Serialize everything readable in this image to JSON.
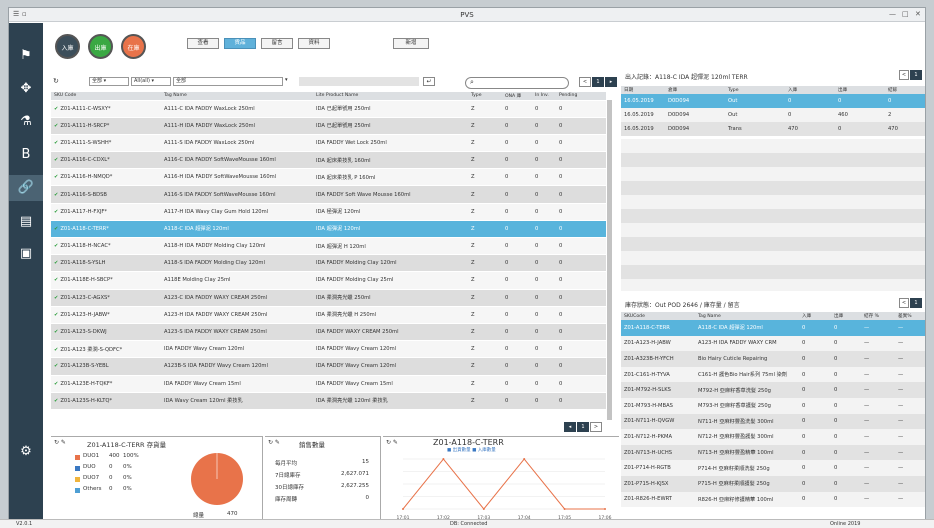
{
  "app": {
    "title": "PVS"
  },
  "sidebar": {
    "items": [
      {
        "icon": "flag-icon",
        "glyph": "⚑"
      },
      {
        "icon": "move-icon",
        "glyph": "✥"
      },
      {
        "icon": "flask-icon",
        "glyph": "⚗"
      },
      {
        "icon": "bold-b-icon",
        "glyph": "B"
      },
      {
        "icon": "link-icon",
        "glyph": "🔗"
      },
      {
        "icon": "document-icon",
        "glyph": "▤"
      },
      {
        "icon": "folder-icon",
        "glyph": "▣"
      },
      {
        "icon": "settings-icon",
        "glyph": "⚙"
      }
    ]
  },
  "circles": [
    {
      "label": "入庫",
      "color": "#3c4e5a"
    },
    {
      "label": "出庫",
      "color": "#3aa843"
    },
    {
      "label": "在庫",
      "color": "#e8734a"
    }
  ],
  "tabs": [
    "查看",
    "貨品",
    "留言",
    "資料"
  ],
  "tab_new": "新增",
  "filters": {
    "f1": "全部",
    "f2": "All(all) ",
    "f3": "全部"
  },
  "main_pager": {
    "prev": "<",
    "current": "1"
  },
  "main_table": {
    "headers": [
      "SKU Code",
      "Tag Name",
      "Lite Product Name",
      "Type",
      "ONA 庫",
      "In Inv.",
      "Pending"
    ],
    "rows": [
      {
        "sku": "Z01-A111-C-WSXY*",
        "tag": "A111-C IDA FADDY WaxLock 250ml",
        "name": "IDA 已起單號用 250ml",
        "type": "Z",
        "a": "0",
        "b": "0",
        "c": "0",
        "cls": "w"
      },
      {
        "sku": "Z01-A111-H-SRCP*",
        "tag": "A111-H IDA FADDY WaxLock 250ml",
        "name": "IDA 已起單號用 250ml",
        "type": "Z",
        "a": "0",
        "b": "0",
        "c": "0",
        "cls": "g"
      },
      {
        "sku": "Z01-A111-S-WSHH*",
        "tag": "A111-S IDA FADDY WaxLock 250ml",
        "name": "IDA FADDY Wet Lock 250ml",
        "type": "Z",
        "a": "0",
        "b": "0",
        "c": "0",
        "cls": "w"
      },
      {
        "sku": "Z01-A116-C-CDXL*",
        "tag": "A116-C IDA FADDY SoftWaveMousse 160ml",
        "name": "IDA 起床柔技乳 160ml",
        "type": "Z",
        "a": "0",
        "b": "0",
        "c": "0",
        "cls": "g"
      },
      {
        "sku": "Z01-A116-H-NMQD*",
        "tag": "A116-H IDA FADDY SoftWaveMousse 160ml",
        "name": "IDA 起床柔技乳 P 160ml",
        "type": "Z",
        "a": "0",
        "b": "0",
        "c": "0",
        "cls": "w"
      },
      {
        "sku": "Z01-A116-S-BDSB",
        "tag": "A116-S IDA FADDY SoftWaveMousse 160ml",
        "name": "IDA FADDY Soft Wave Mousse 160ml",
        "type": "Z",
        "a": "0",
        "b": "0",
        "c": "0",
        "cls": "g"
      },
      {
        "sku": "Z01-A117-H-FXJF*",
        "tag": "A117-H IDA Wavy Clay Gum Hold 120ml",
        "name": "IDA 極彈泥 120ml",
        "type": "Z",
        "a": "0",
        "b": "0",
        "c": "0",
        "cls": "w"
      },
      {
        "sku": "Z01-A118-C-TERR*",
        "tag": "A118-C IDA 超彈泥 120ml",
        "name": "IDA 超彈泥 120ml",
        "type": "Z",
        "a": "0",
        "b": "0",
        "c": "0",
        "cls": "sel"
      },
      {
        "sku": "Z01-A118-H-NCAC*",
        "tag": "A118-H IDA FADDY Molding Clay 120ml",
        "name": "IDA 超彈泥 H 120ml",
        "type": "Z",
        "a": "0",
        "b": "0",
        "c": "0",
        "cls": "w"
      },
      {
        "sku": "Z01-A118-S-YSLH",
        "tag": "A118-S IDA FADDY Molding Clay 120ml",
        "name": "IDA FADDY Molding Clay 120ml",
        "type": "Z",
        "a": "0",
        "b": "0",
        "c": "0",
        "cls": "g"
      },
      {
        "sku": "Z01-A118E-H-SBCP*",
        "tag": "A118E Molding Clay 25ml",
        "name": "IDA FADDY Molding Clay 25ml",
        "type": "Z",
        "a": "0",
        "b": "0",
        "c": "0",
        "cls": "w"
      },
      {
        "sku": "Z01-A123-C-AGXS*",
        "tag": "A123-C IDA FADDY WAXY CREAM 250ml",
        "name": "IDA 柔潤亮光蠟 250ml",
        "type": "Z",
        "a": "0",
        "b": "0",
        "c": "0",
        "cls": "g"
      },
      {
        "sku": "Z01-A123-H-JABW*",
        "tag": "A123-H IDA FADDY WAXY CREAM 250ml",
        "name": "IDA 柔潤亮光蠟 H 250ml",
        "type": "Z",
        "a": "0",
        "b": "0",
        "c": "0",
        "cls": "w"
      },
      {
        "sku": "Z01-A123-S-DKWJ",
        "tag": "A123-S IDA FADDY WAXY CREAM 250ml",
        "name": "IDA FADDY WAXY CREAM 250ml",
        "type": "Z",
        "a": "0",
        "b": "0",
        "c": "0",
        "cls": "g"
      },
      {
        "sku": "Z01-A123 柔潤-S-QDFC*",
        "tag": "IDA FADDY Wavy Cream 120ml",
        "name": "IDA FADDY Wavy Cream 120ml",
        "type": "Z",
        "a": "0",
        "b": "0",
        "c": "0",
        "cls": "w"
      },
      {
        "sku": "Z01-A123B-S-YEBL",
        "tag": "A123B-S IDA FADDY Wavy Cream 120ml",
        "name": "IDA FADDY Wavy Cream 120ml",
        "type": "Z",
        "a": "0",
        "b": "0",
        "c": "0",
        "cls": "g"
      },
      {
        "sku": "Z01-A123E-H-TQKF*",
        "tag": "IDA FADDY Wavy Cream 15ml",
        "name": "IDA FADDY Wavy Cream 15ml",
        "type": "Z",
        "a": "0",
        "b": "0",
        "c": "0",
        "cls": "w"
      },
      {
        "sku": "Z01-A123S-H-KLTQ*",
        "tag": "IDA Wavy Cream 120ml 柔技乳",
        "name": "IDA 柔潤亮光蠟 120ml 柔技乳",
        "type": "Z",
        "a": "0",
        "b": "0",
        "c": "0",
        "cls": "g"
      }
    ]
  },
  "bottom_pager": {
    "page": "1",
    "next": ">"
  },
  "right_top": {
    "title": "出入記錄：A118-C IDA 超彈泥 120ml TERR",
    "headers": [
      "日期",
      "倉庫",
      "Type",
      "入庫",
      "出庫",
      "結餘"
    ],
    "rows": [
      {
        "date": "16.05.2019",
        "wh": "D0D094",
        "type": "Out",
        "in": "0",
        "out": "0",
        "bal": "0",
        "cls": "sel"
      },
      {
        "date": "16.05.2019",
        "wh": "D0D094",
        "type": "Out",
        "in": "0",
        "out": "460",
        "bal": "2",
        "cls": "w"
      },
      {
        "date": "16.05.2019",
        "wh": "D0D094",
        "type": "Trans",
        "in": "470",
        "out": "0",
        "bal": "470",
        "cls": "g"
      }
    ]
  },
  "right_bottom": {
    "title": "庫存狀態：Out POD 2646 / 庫存量 / 留言",
    "headers": [
      "SKUCode",
      "Tag Name",
      "入庫",
      "出庫",
      "結存 %",
      "差異%"
    ],
    "rows": [
      {
        "a": "Z01-A118-C-TERR",
        "b": "A118-C IDA 超彈泥 120ml",
        "c": "0",
        "d": "0",
        "e": "—",
        "f": "—",
        "cls": "sel"
      },
      {
        "a": "Z01-A123-H-JABW",
        "b": "A123-H IDA FADDY WAXY CRM",
        "c": "0",
        "d": "0",
        "e": "—",
        "f": "—",
        "cls": "w"
      },
      {
        "a": "Z01-A323B-H-YFCH",
        "b": "Bio Hairy Cuticle Repairing",
        "c": "0",
        "d": "0",
        "e": "—",
        "f": "—",
        "cls": "g"
      },
      {
        "a": "Z01-C161-H-TYVA",
        "b": "C161-H 護色Bio Hair系列 75ml 染劑",
        "c": "0",
        "d": "0",
        "e": "—",
        "f": "—",
        "cls": "w"
      },
      {
        "a": "Z01-M792-H-SLKS",
        "b": "M792-H 亞麻籽香草洗髮 250g",
        "c": "0",
        "d": "0",
        "e": "—",
        "f": "—",
        "cls": "g"
      },
      {
        "a": "Z01-M793-H-MBAS",
        "b": "M793-H 亞麻籽香草護髮 250g",
        "c": "0",
        "d": "0",
        "e": "—",
        "f": "—",
        "cls": "w"
      },
      {
        "a": "Z01-N711-H-QVGW",
        "b": "N711-H 亞麻籽豐盈洗髮 300ml",
        "c": "0",
        "d": "0",
        "e": "—",
        "f": "—",
        "cls": "g"
      },
      {
        "a": "Z01-N712-H-PKMA",
        "b": "N712-H 亞麻籽豐盈護髮 300ml",
        "c": "0",
        "d": "0",
        "e": "—",
        "f": "—",
        "cls": "w"
      },
      {
        "a": "Z01-N713-H-UCHS",
        "b": "N713-H 亞麻籽豐盈精華 100ml",
        "c": "0",
        "d": "0",
        "e": "—",
        "f": "—",
        "cls": "g"
      },
      {
        "a": "Z01-P714-H-RGTB",
        "b": "P714-H 亞麻籽柔順洗髮 250g",
        "c": "0",
        "d": "0",
        "e": "—",
        "f": "—",
        "cls": "w"
      },
      {
        "a": "Z01-P715-H-KJSX",
        "b": "P715-H 亞麻籽柔順護髮 250g",
        "c": "0",
        "d": "0",
        "e": "—",
        "f": "—",
        "cls": "g"
      },
      {
        "a": "Z01-R826-H-EWRT",
        "b": "R826-H 亞麻籽修護精華 100ml",
        "c": "0",
        "d": "0",
        "e": "—",
        "f": "—",
        "cls": "w"
      }
    ]
  },
  "pie_panel": {
    "title": "Z01-A118-C-TERR 存貨量",
    "legend": [
      {
        "name": "DUO1",
        "qty": "400",
        "pct": "100%",
        "color": "#e8734a"
      },
      {
        "name": "DUO",
        "qty": "0",
        "pct": "0%",
        "color": "#3a78c2"
      },
      {
        "name": "DUO7",
        "qty": "0",
        "pct": "0%",
        "color": "#f0b43c"
      },
      {
        "name": "Others",
        "qty": "0",
        "pct": "0%",
        "color": "#4e9fd4"
      }
    ],
    "total_label": "總量",
    "total": "470"
  },
  "stats_panel": {
    "title": "銷售數量",
    "rows": [
      {
        "k": "每月平均",
        "v": "15"
      },
      {
        "k": "7日總庫存",
        "v": "2,627.071"
      },
      {
        "k": "30日總庫存",
        "v": "2,627.255"
      },
      {
        "k": "庫存周轉",
        "v": "0"
      }
    ]
  },
  "line_panel": {
    "title": "Z01-A118-C-TERR",
    "legend": "■ 出貨數量 ■ 入庫數量",
    "x_labels": [
      "17:01",
      "17:02",
      "17:03",
      "17:04",
      "17:05",
      "17:06"
    ]
  },
  "chart_data": {
    "type": "line",
    "title": "Z01-A118-C-TERR",
    "x": [
      "17:01",
      "17:02",
      "17:03",
      "17:04",
      "17:05",
      "17:06"
    ],
    "series": [
      {
        "name": "出貨數量",
        "values": [
          0,
          470,
          0,
          470,
          0,
          0
        ]
      }
    ]
  },
  "status": {
    "left": "V2.0.1",
    "center": "DB: Connected",
    "right": "Online 2019"
  },
  "colors": {
    "sidebar": "#2d4150",
    "selected": "#58b4dc",
    "accent": "#e8734a"
  }
}
